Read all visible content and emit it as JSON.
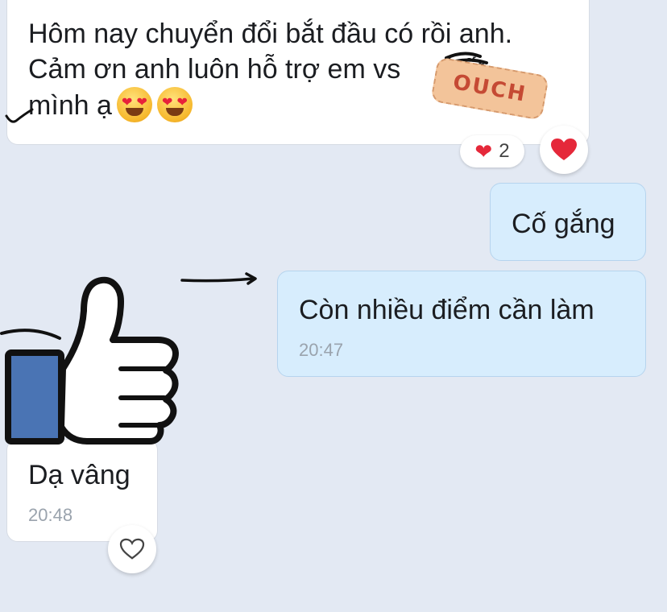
{
  "messages": [
    {
      "id": "m1",
      "side": "incoming",
      "text": "Hôm nay chuyển đổi bắt đầu có rồi anh.\nCảm ơn anh luôn hỗ trợ em vs      hết\nmình ạ",
      "time": ""
    },
    {
      "id": "m2",
      "side": "outgoing",
      "text": "Cố gắng",
      "time": ""
    },
    {
      "id": "m3",
      "side": "outgoing",
      "text": "Còn nhiều điểm cần làm",
      "time": "20:47"
    },
    {
      "id": "m4",
      "side": "incoming",
      "text": "Dạ vâng",
      "time": "20:48"
    }
  ],
  "reaction": {
    "icon": "heart-icon",
    "count": "2"
  },
  "stickers": {
    "ouch": "OUCH",
    "thumb": "thumbs-up-icon"
  },
  "colors": {
    "background": "#e3e9f3",
    "incoming_bubble": "#ffffff",
    "outgoing_bubble": "#d7edfd",
    "heart": "#e5283a",
    "thumb_cuff": "#4a74b4"
  }
}
